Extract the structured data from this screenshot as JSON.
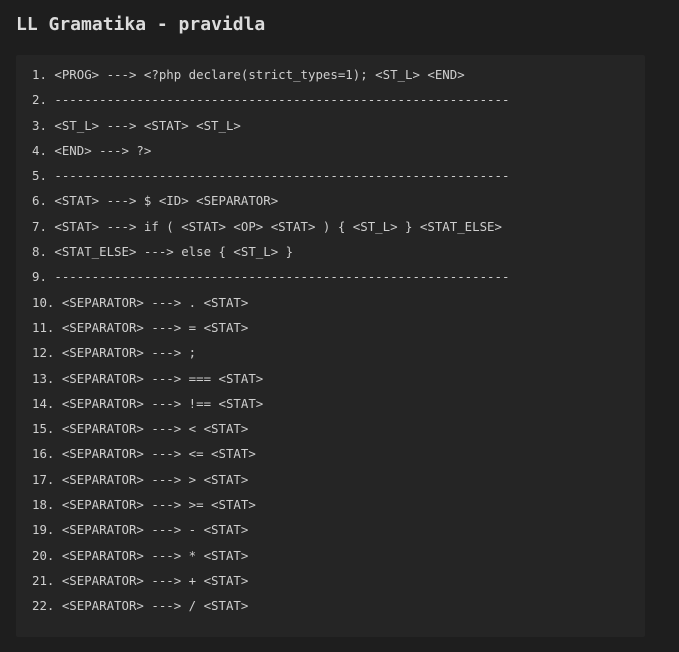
{
  "heading": "LL Gramatika - pravidla",
  "rules": [
    "1. <PROG> ---> <?php declare(strict_types=1); <ST_L> <END>",
    "2. -------------------------------------------------------------",
    "3. <ST_L> ---> <STAT> <ST_L>",
    "4. <END> ---> ?>",
    "5. -------------------------------------------------------------",
    "6. <STAT> ---> $ <ID> <SEPARATOR>",
    "7. <STAT> ---> if ( <STAT> <OP> <STAT> ) { <ST_L> } <STAT_ELSE>",
    "8. <STAT_ELSE> ---> else { <ST_L> }",
    "9. -------------------------------------------------------------",
    "10. <SEPARATOR> ---> . <STAT>",
    "11. <SEPARATOR> ---> = <STAT>",
    "12. <SEPARATOR> ---> ;",
    "13. <SEPARATOR> ---> === <STAT>",
    "14. <SEPARATOR> ---> !== <STAT>",
    "15. <SEPARATOR> ---> < <STAT>",
    "16. <SEPARATOR> ---> <= <STAT>",
    "17. <SEPARATOR> ---> > <STAT>",
    "18. <SEPARATOR> ---> >= <STAT>",
    "19. <SEPARATOR> ---> - <STAT>",
    "20. <SEPARATOR> ---> * <STAT>",
    "21. <SEPARATOR> ---> + <STAT>",
    "22. <SEPARATOR> ---> / <STAT>"
  ]
}
